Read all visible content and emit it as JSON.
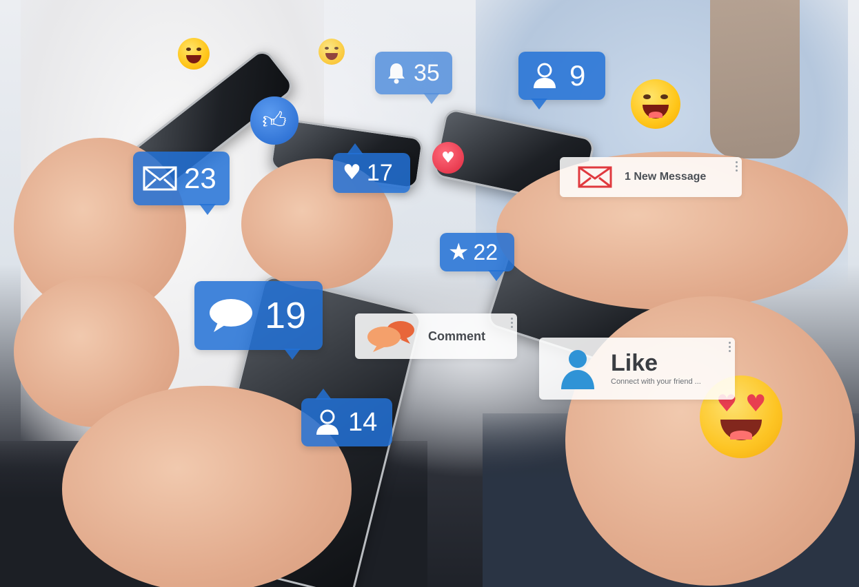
{
  "bubbles": {
    "bell": {
      "icon": "bell-icon",
      "count": "35"
    },
    "user_top": {
      "icon": "user-icon",
      "count": "9"
    },
    "mail": {
      "icon": "envelope-icon",
      "count": "23"
    },
    "heart": {
      "icon": "heart-icon",
      "count": "17"
    },
    "star": {
      "icon": "star-icon",
      "count": "22"
    },
    "comment": {
      "icon": "speech-bubble-icon",
      "count": "19"
    },
    "user_bottom": {
      "icon": "user-icon",
      "count": "14"
    }
  },
  "cards": {
    "message": {
      "icon": "envelope-icon",
      "label": "1 New Message"
    },
    "comment": {
      "icon": "chat-bubbles-icon",
      "label": "Comment"
    },
    "like": {
      "icon": "user-icon",
      "title": "Like",
      "subtitle": "Connect with your friend ..."
    }
  },
  "icons": {
    "thumbs_up": "thumbs-up-icon",
    "heart_red": "heart-icon"
  },
  "colors": {
    "bubble_blue": "#2271d6",
    "envelope_red": "#e0393e",
    "comment_orange": "#f08a4b",
    "like_blue": "#2f93d6"
  }
}
